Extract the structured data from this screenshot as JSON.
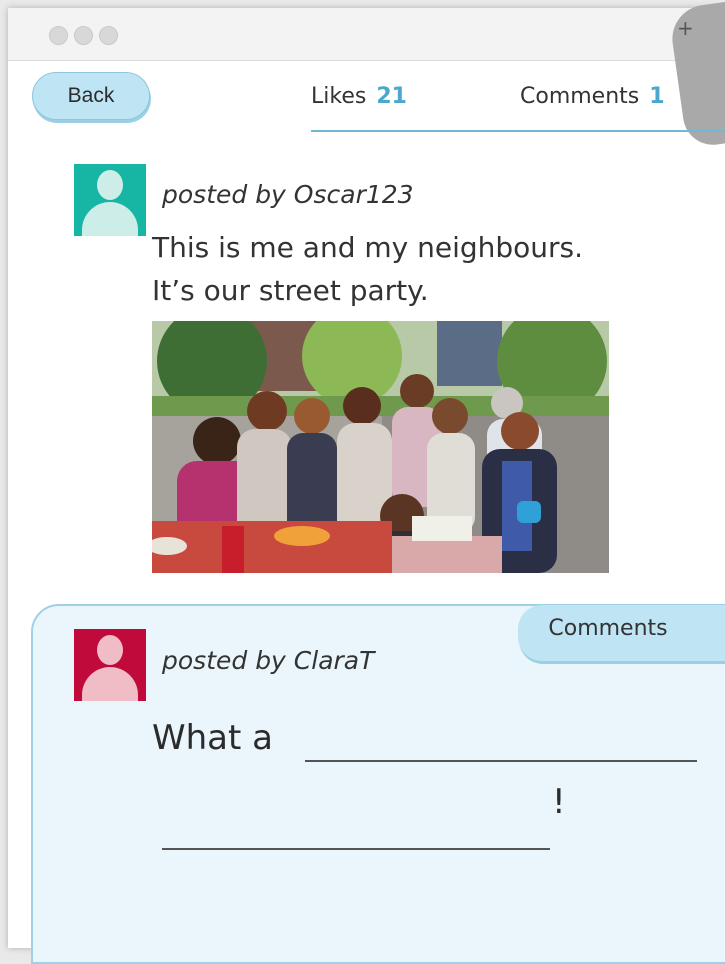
{
  "nav": {
    "back_label": "Back"
  },
  "tabs": [
    {
      "label": "Likes",
      "count": "21"
    },
    {
      "label": "Comments",
      "count": "1"
    }
  ],
  "window": {
    "new_tab_symbol": "+"
  },
  "post": {
    "author_line": "posted by Oscar123",
    "text_line1": "This is me and my neighbours.",
    "text_line2": "It’s our street party.",
    "avatar_color": "#17b5a4"
  },
  "comment": {
    "tab_label": "Comments",
    "author_line": "posted by ClaraT",
    "prompt_start": "What a",
    "prompt_end": "!",
    "avatar_color": "#c00a3c"
  },
  "colors": {
    "accent": "#4aa8cf",
    "button_fill": "#bfe4f3",
    "panel_fill": "#eaf6fc"
  }
}
